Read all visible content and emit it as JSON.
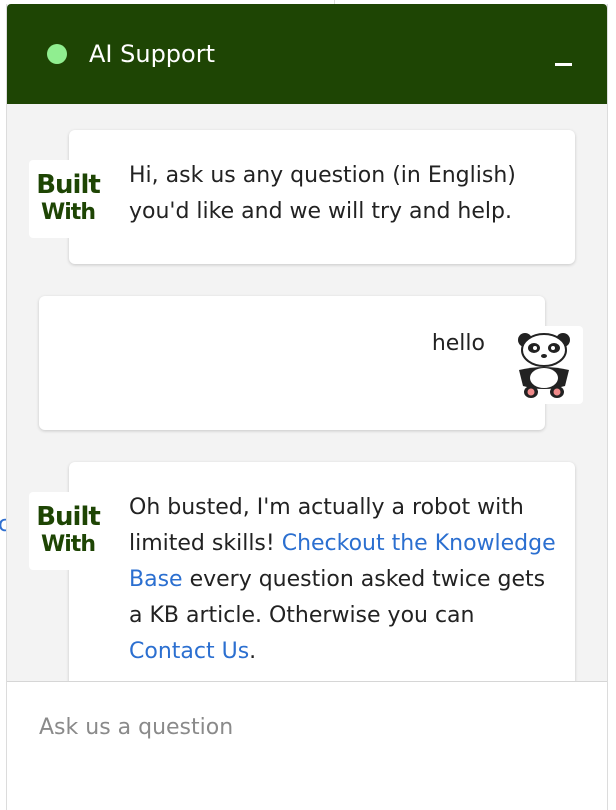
{
  "header": {
    "title": "AI Support",
    "status_color": "#90ee90",
    "background_color": "#1e4504",
    "minimize_label": "_"
  },
  "messages": [
    {
      "sender": "bot",
      "avatar_logo": [
        "Built",
        "With"
      ],
      "text": "Hi, ask us any question (in English) you'd like and we will try and help."
    },
    {
      "sender": "user",
      "avatar_icon": "panda-icon",
      "text": "hello"
    },
    {
      "sender": "bot",
      "avatar_logo": [
        "Built",
        "With"
      ],
      "text_before": "Oh busted, I'm actually a robot with limited skills! ",
      "link1": "Checkout the Knowledge Base",
      "text_middle": " every question asked twice gets a KB article. Otherwise you can ",
      "link2": "Contact Us",
      "text_after": "."
    }
  ],
  "composer": {
    "placeholder": "Ask us a question",
    "value": ""
  },
  "colors": {
    "link": "#2b6fd0",
    "panel_background": "#f3f3f3",
    "logo": "#1e4504"
  }
}
